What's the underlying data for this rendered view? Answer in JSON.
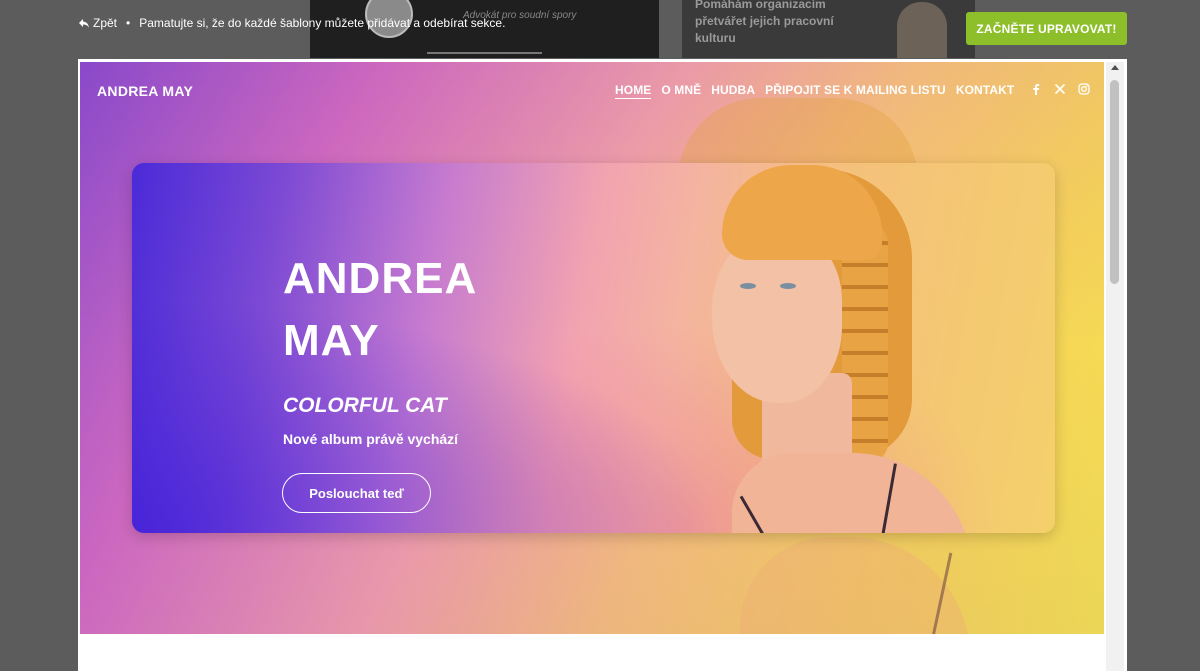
{
  "editor": {
    "back_label": "Zpět",
    "separator": "•",
    "notice": "Pamatujte si, že do každé šablony můžete přidávat a odebírat sekce.",
    "cta_label": "ZAČNĚTE UPRAVOVAT!",
    "cta_color": "#8cbf2a",
    "bg_card_1_text": "Advokát pro soudní spory",
    "bg_card_2_text": "Pomáhám organizacím přetvářet jejich pracovní kulturu"
  },
  "site": {
    "logo": "ANDREA MAY",
    "nav": [
      {
        "label": "HOME",
        "active": true
      },
      {
        "label": "O MNĚ"
      },
      {
        "label": "HUDBA"
      },
      {
        "label": "PŘIPOJIT SE K MAILING LISTU"
      },
      {
        "label": "KONTAKT"
      }
    ],
    "social": [
      "facebook-icon",
      "x-icon",
      "instagram-icon"
    ],
    "hero": {
      "title_line_1": "ANDREA",
      "title_line_2": "MAY",
      "subtitle": "COLORFUL CAT",
      "description": "Nové album právě vychází",
      "button_label": "Poslouchat teď"
    }
  }
}
